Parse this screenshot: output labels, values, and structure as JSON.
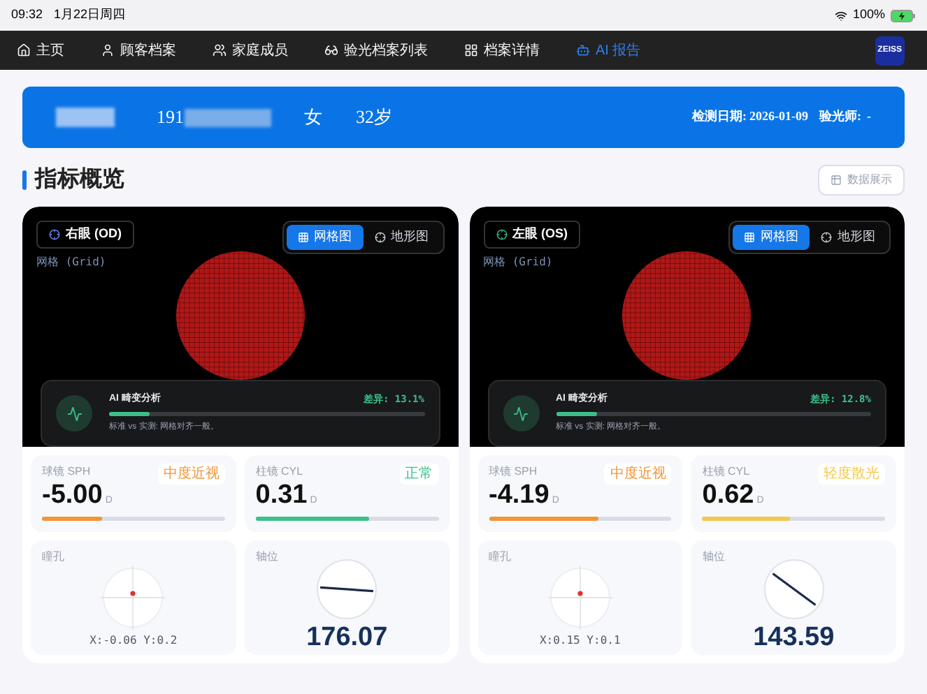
{
  "status_bar": {
    "time": "09:32",
    "date": "1月22日周四",
    "battery": "100%"
  },
  "nav": {
    "items": [
      {
        "label": "主页",
        "selected": false
      },
      {
        "label": "顾客档案",
        "selected": false
      },
      {
        "label": "家庭成员",
        "selected": false
      },
      {
        "label": "验光档案列表",
        "selected": false
      },
      {
        "label": "档案详情",
        "selected": false
      },
      {
        "label": "AI 报告",
        "selected": true
      }
    ],
    "logo": "ZEISS"
  },
  "banner": {
    "phone_prefix": "191",
    "gender": "女",
    "age": "32岁",
    "date_label": "检测日期:",
    "date": "2026-01-09",
    "optometrist_label": "验光师:",
    "optometrist": "-"
  },
  "section": {
    "title": "指标概览",
    "button": "数据展示"
  },
  "eyes": [
    {
      "label": "右眼 (OD)",
      "tabs": [
        {
          "label": "网格图",
          "selected": true
        },
        {
          "label": "地形图",
          "selected": false
        }
      ],
      "mode_label": "网格 (Grid)",
      "analysis": {
        "title": "AI 畸变分析",
        "diff": "差异: 13.1%",
        "level": 0.13,
        "note": "标准 vs 实测: 网格对齐一般。"
      },
      "sph": {
        "label": "球镜 SPH",
        "value": "-5.00",
        "unit": "D",
        "tag": "中度近视",
        "color": "#f0953a",
        "level": 0.33
      },
      "cyl": {
        "label": "柱镜 CYL",
        "value": "0.31",
        "unit": "D",
        "tag": "正常",
        "color": "#3cc08a",
        "level": 0.62
      },
      "pupil": {
        "label": "瞳孔",
        "coords": "X:-0.06 Y:0.2"
      },
      "axis": {
        "label": "轴位",
        "value": "176.07"
      }
    },
    {
      "label": "左眼 (OS)",
      "tabs": [
        {
          "label": "网格图",
          "selected": true
        },
        {
          "label": "地形图",
          "selected": false
        }
      ],
      "mode_label": "网格 (Grid)",
      "analysis": {
        "title": "AI 畸变分析",
        "diff": "差异: 12.8%",
        "level": 0.13,
        "note": "标准 vs 实测: 网格对齐一般。"
      },
      "sph": {
        "label": "球镜 SPH",
        "value": "-4.19",
        "unit": "D",
        "tag": "中度近视",
        "color": "#f0953a",
        "level": 0.6
      },
      "cyl": {
        "label": "柱镜 CYL",
        "value": "0.62",
        "unit": "D",
        "tag": "轻度散光",
        "color": "#f2c94c",
        "level": 0.48
      },
      "pupil": {
        "label": "瞳孔",
        "coords": "X:0.15 Y:0.1"
      },
      "axis": {
        "label": "轴位",
        "value": "143.59"
      }
    }
  ]
}
